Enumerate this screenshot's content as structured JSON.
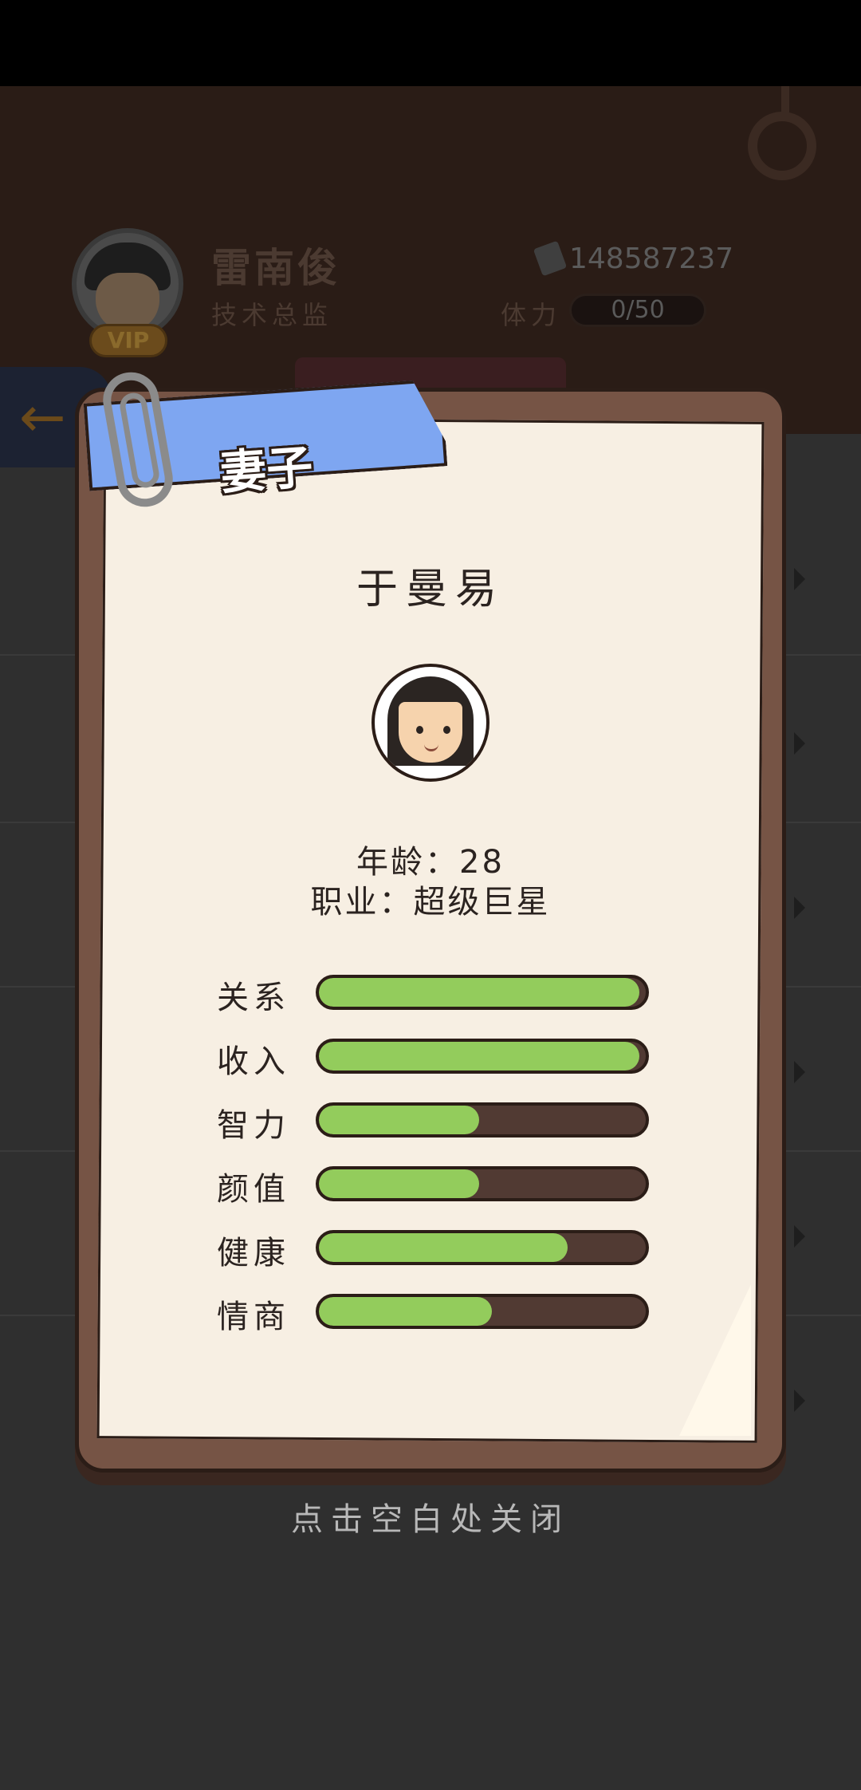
{
  "header": {
    "player_name": "雷南俊",
    "player_role": "技术总监",
    "vip_label": "VIP",
    "money": "148587237",
    "stamina_label": "体力",
    "stamina_value": "0/50"
  },
  "popup": {
    "tag_label": "妻子",
    "person_name": "于曼易",
    "age_line": "年龄：28",
    "job_line": "职业：超级巨星",
    "stats": [
      {
        "label": "关系",
        "value": 0.98
      },
      {
        "label": "收入",
        "value": 0.98
      },
      {
        "label": "智力",
        "value": 0.49
      },
      {
        "label": "颜值",
        "value": 0.49
      },
      {
        "label": "健康",
        "value": 0.76
      },
      {
        "label": "情商",
        "value": 0.53
      }
    ],
    "close_hint": "点击空白处关闭"
  },
  "colors": {
    "tag_blue": "#7ea6f1",
    "bar_green": "#93cc5c",
    "card_brown": "#765445",
    "paper": "#f7efe3"
  }
}
